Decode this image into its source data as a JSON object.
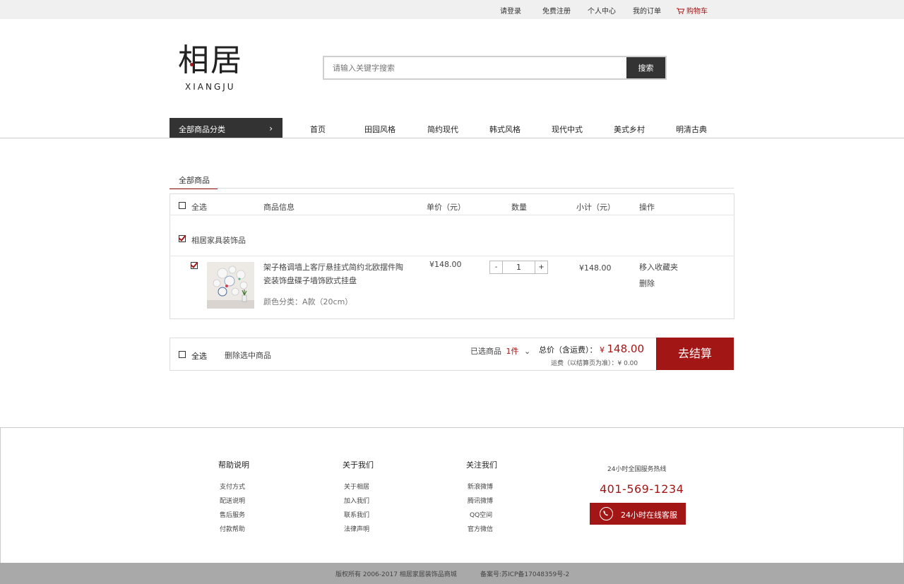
{
  "topbar": {
    "login": "请登录",
    "register": "免费注册",
    "account": "个人中心",
    "orders": "我的订单",
    "cart": "购物车"
  },
  "logo": {
    "chinese": "相居",
    "pinyin": "XIANGJU"
  },
  "search": {
    "placeholder": "请输入关键字搜索",
    "button": "搜索"
  },
  "nav": {
    "all_categories": "全部商品分类",
    "items": [
      "首页",
      "田园风格",
      "简约现代",
      "韩式风格",
      "现代中式",
      "美式乡村",
      "明清古典"
    ]
  },
  "cart": {
    "tab": "全部商品",
    "headers": {
      "select_all": "全选",
      "info": "商品信息",
      "unit_price": "单价（元）",
      "quantity": "数量",
      "subtotal": "小计（元）",
      "action": "操作"
    },
    "shop_name": "相居家具装饰品",
    "item": {
      "title_line1": "架子格调墙上客厅悬挂式简约北欧摆件陶",
      "title_line2": "瓷装饰盘碟子墙饰欧式挂盘",
      "spec": "颜色分类：A款（20cm）",
      "price": "¥148.00",
      "qty_minus": "-",
      "qty": "1",
      "qty_plus": "+",
      "subtotal": "¥148.00",
      "move_fav": "移入收藏夹",
      "delete": "删除",
      "checked": true
    },
    "summary": {
      "select_all": "全选",
      "delete_selected": "删除选中商品",
      "selected_label": "已选商品",
      "selected_count": "1件",
      "total_label": "总价（含运费）：",
      "total_symbol": "¥",
      "total_value": "148.00",
      "shipping": "运费（以结算页为准）：¥ 0.00",
      "checkout": "去结算"
    }
  },
  "footer": {
    "col1": {
      "title": "帮助说明",
      "links": [
        "支付方式",
        "配送说明",
        "售后服务",
        "付款帮助"
      ]
    },
    "col2": {
      "title": "关于我们",
      "links": [
        "关于相居",
        "加入我们",
        "联系我们",
        "法律声明"
      ]
    },
    "col3": {
      "title": "关注我们",
      "links": [
        "新浪微博",
        "腾讯微博",
        "QQ空间",
        "官方微信"
      ]
    },
    "hotline_label": "24小时全国服务热线",
    "phone": "401-569-1234",
    "service_button": "24小时在线客服",
    "copyright": "版权所有 2006-2017 相居家居装饰品商城",
    "icp": "备案号:苏ICP备17048359号-2"
  },
  "colors": {
    "accent": "#a31616",
    "dark": "#333333",
    "bottom_bar": "#a9a9a9"
  }
}
